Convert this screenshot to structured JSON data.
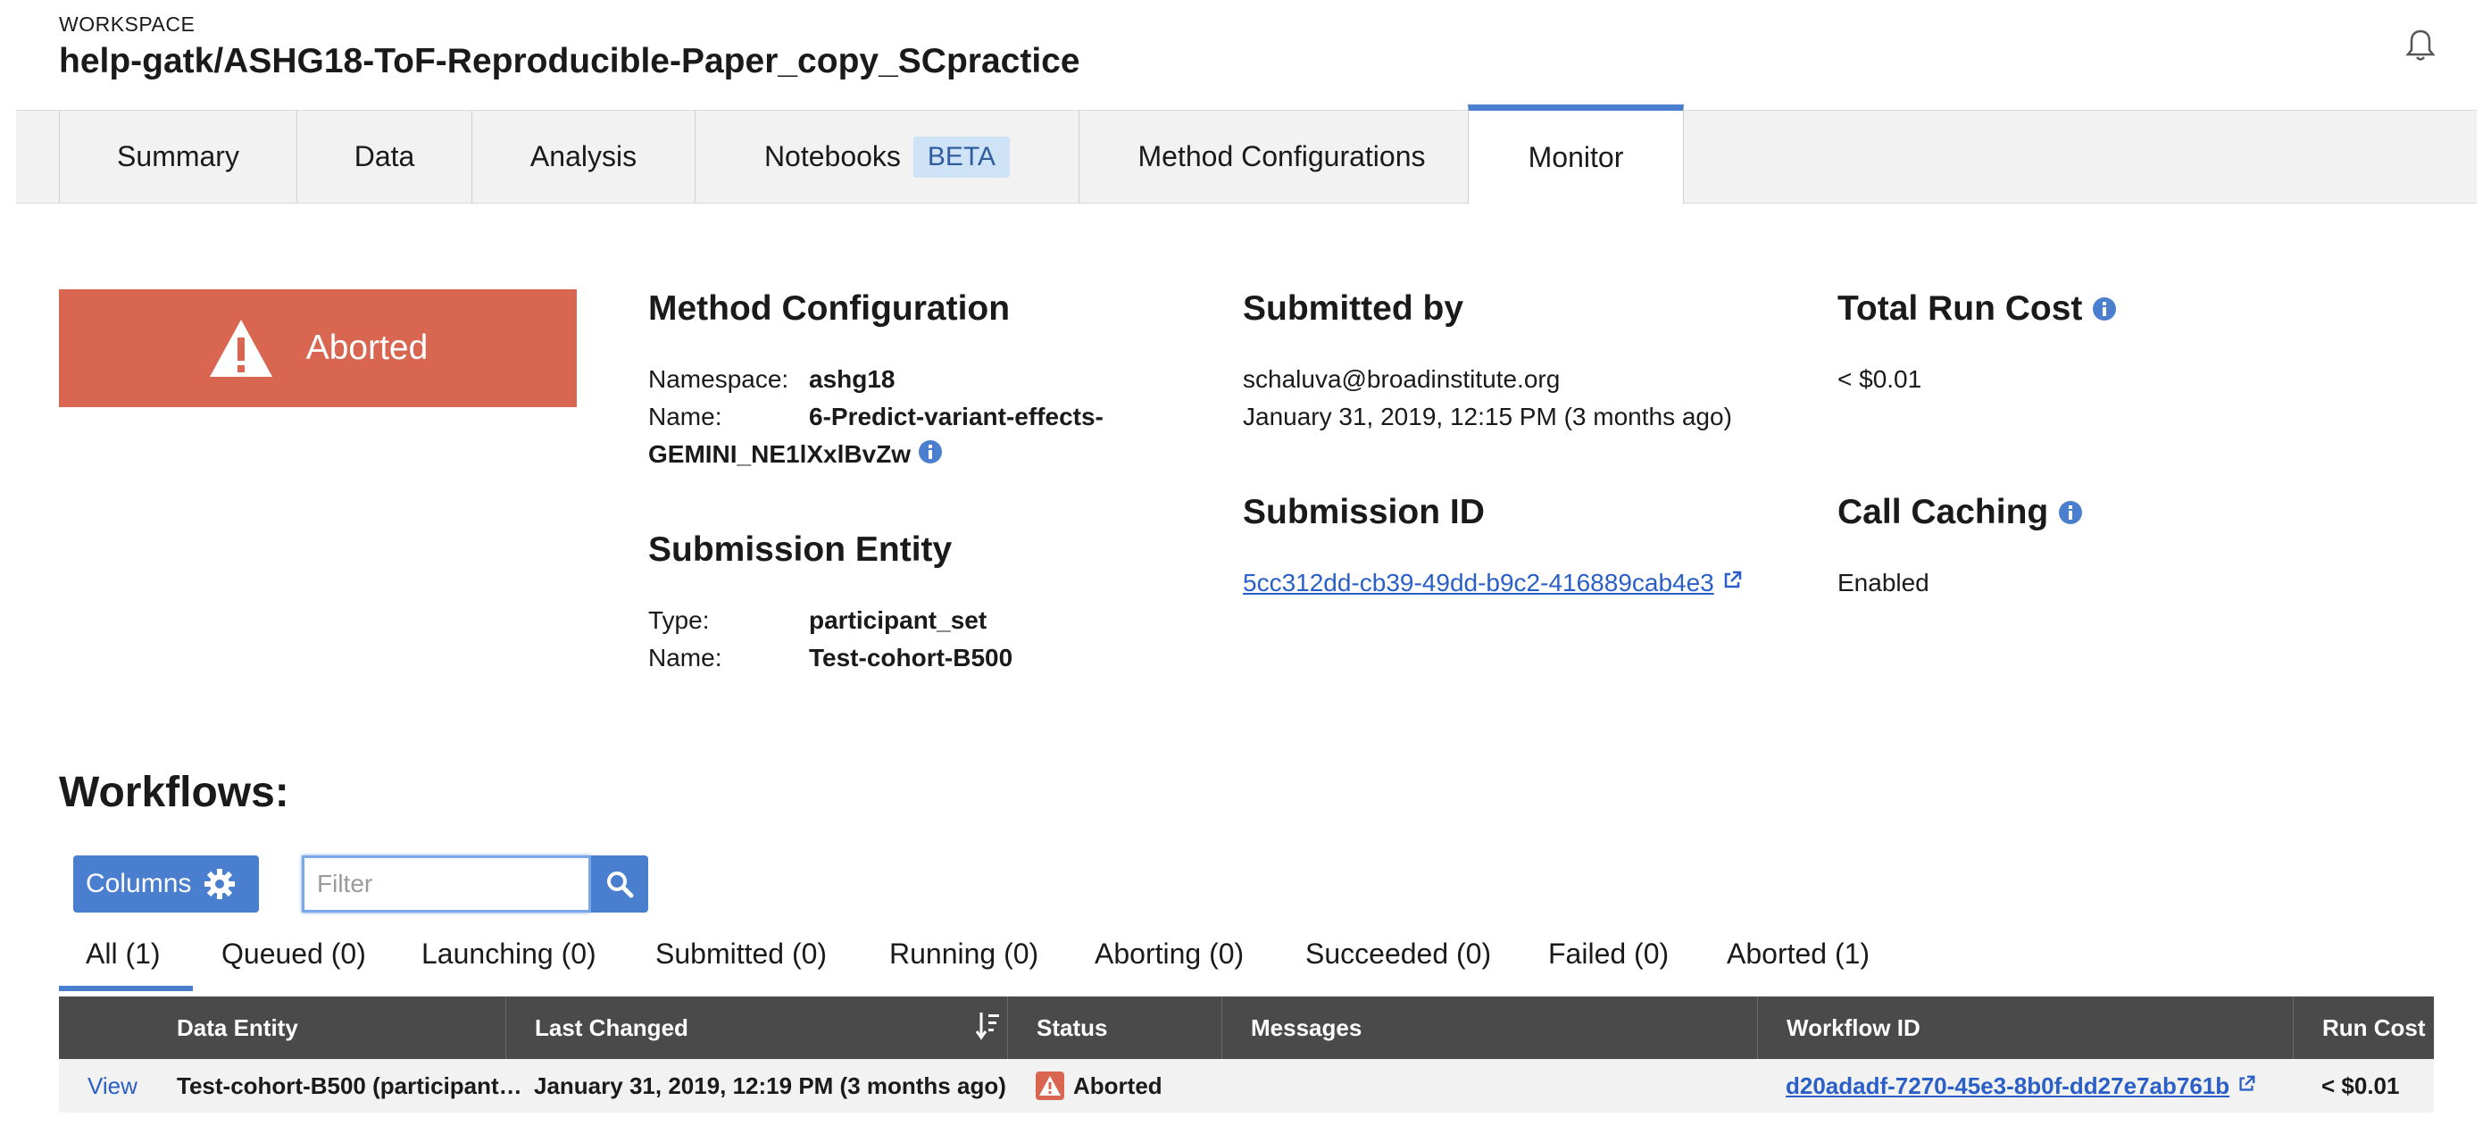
{
  "header": {
    "label": "WORKSPACE",
    "workspace_name": "help-gatk/ASHG18-ToF-Reproducible-Paper_copy_SCpractice"
  },
  "tabs": {
    "summary": "Summary",
    "data": "Data",
    "analysis": "Analysis",
    "notebooks": "Notebooks",
    "notebooks_badge": "BETA",
    "method_configs": "Method Configurations",
    "monitor": "Monitor"
  },
  "status": {
    "label": "Aborted",
    "color": "#d96650"
  },
  "method_configuration": {
    "title": "Method Configuration",
    "namespace_key": "Namespace:",
    "namespace_value": "ashg18",
    "name_key": "Name:",
    "name_value_line1": "6-Predict-variant-effects-",
    "name_value_line2": "GEMINI_NE1lXxlBvZw"
  },
  "submission_entity": {
    "title": "Submission Entity",
    "type_key": "Type:",
    "type_value": "participant_set",
    "name_key": "Name:",
    "name_value": "Test-cohort-B500"
  },
  "submitted_by": {
    "title": "Submitted by",
    "email": "schaluva@broadinstitute.org",
    "date": "January 31, 2019, 12:15 PM (3 months ago)"
  },
  "submission_id": {
    "title": "Submission ID",
    "value": "5cc312dd-cb39-49dd-b9c2-416889cab4e3"
  },
  "total_run_cost": {
    "title": "Total Run Cost",
    "value": "< $0.01"
  },
  "call_caching": {
    "title": "Call Caching",
    "value": "Enabled"
  },
  "workflows": {
    "title": "Workflows:",
    "columns_label": "Columns",
    "filter_placeholder": "Filter",
    "filters": {
      "all": "All (1)",
      "queued": "Queued (0)",
      "launching": "Launching (0)",
      "submitted": "Submitted (0)",
      "running": "Running (0)",
      "aborting": "Aborting (0)",
      "succeeded": "Succeeded (0)",
      "failed": "Failed (0)",
      "aborted": "Aborted (1)"
    },
    "columns": {
      "data_entity": "Data Entity",
      "last_changed": "Last Changed",
      "status": "Status",
      "messages": "Messages",
      "workflow_id": "Workflow ID",
      "run_cost": "Run Cost"
    },
    "rows": [
      {
        "view": "View",
        "data_entity": "Test-cohort-B500 (participant…",
        "last_changed": "January 31, 2019, 12:19 PM (3 months ago)",
        "status": "Aborted",
        "messages": "",
        "workflow_id": "d20adadf-7270-45e3-8b0f-dd27e7ab761b",
        "run_cost": "< $0.01"
      }
    ]
  }
}
